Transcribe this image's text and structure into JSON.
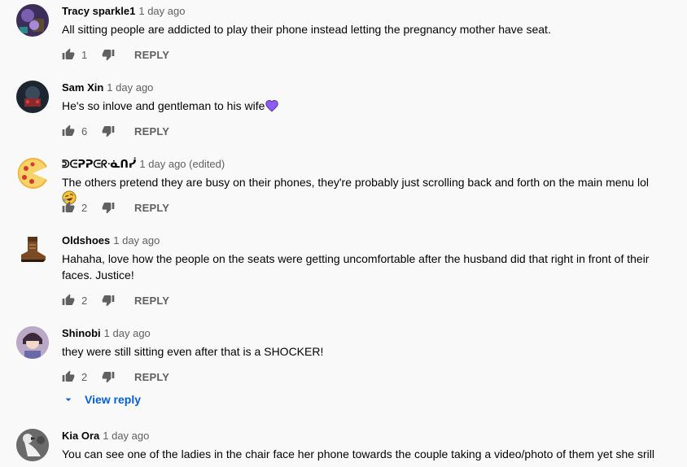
{
  "comments": [
    {
      "author": "Tracy sparkle1",
      "time": "1 day ago",
      "text": "All sitting people are addicted to play their phone instead letting the pregnancy mother have seat.",
      "likes": "1",
      "reply_label": "REPLY",
      "avatar": "avatar-fantasy-art"
    },
    {
      "author": "Sam Xin",
      "time": "1 day ago",
      "text": "He's so inlove and gentleman to his wife",
      "emoji": "purple-heart",
      "likes": "6",
      "reply_label": "REPLY",
      "avatar": "avatar-dark-scene"
    },
    {
      "author": "ᕲᕮᕈᕈᕮᖇᓍᑎᓰ",
      "time": "1 day ago (edited)",
      "text": "The others pretend they are busy on their phones, they're probably just scrolling back and forth on the main menu lol",
      "emoji": "rolling-on-floor-laughing",
      "likes": "2",
      "reply_label": "REPLY",
      "avatar": "avatar-pizza"
    },
    {
      "author": "Oldshoes",
      "time": "1 day ago",
      "text": "Hahaha, love how the people on the seats were getting uncomfortable after the husband did that right in front of their faces. Justice!",
      "likes": "2",
      "reply_label": "REPLY",
      "avatar": "avatar-boot"
    },
    {
      "author": "Shinobi",
      "time": "1 day ago",
      "text": "they were still sitting even after that is a SHOCKER!",
      "likes": "2",
      "reply_label": "REPLY",
      "avatar": "avatar-anime-character",
      "view_replies_label": "View reply"
    },
    {
      "author": "Kia Ora",
      "time": "1 day ago",
      "text": "You can see one of the ladies in the chair face her phone towards the couple taking a video/photo of them yet she srill",
      "avatar": "avatar-bird"
    }
  ],
  "icons": {
    "like": "thumb-up-icon",
    "dislike": "thumb-down-icon",
    "expand": "caret-down-icon"
  },
  "colors": {
    "background": "#f9f9f9",
    "author": "#030303",
    "meta": "#606060",
    "link": "#065fd4",
    "heart": "#8b5cf6"
  }
}
